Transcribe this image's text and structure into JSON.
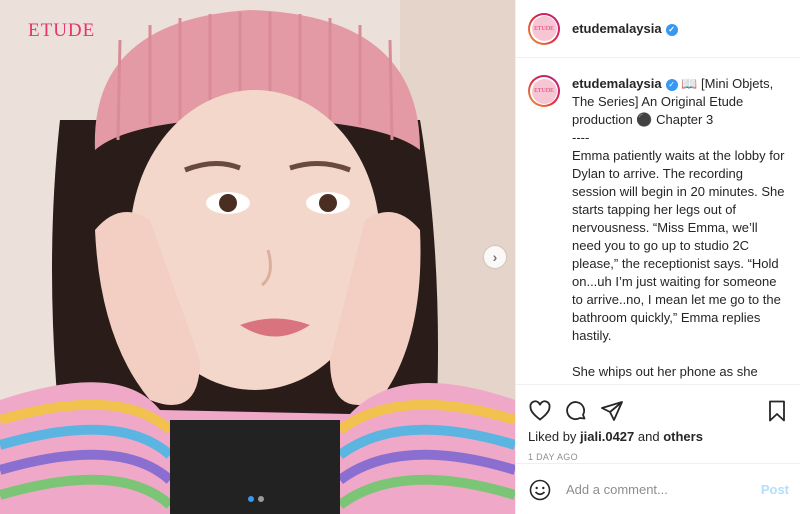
{
  "media": {
    "brand": "ETUDE",
    "next_icon": "chevron-right-icon",
    "carousel_total": 2,
    "carousel_active": 1
  },
  "header": {
    "avatar_text": "ETUDE",
    "username": "etudemalaysia",
    "verified_icon": "verified-badge-icon"
  },
  "caption": {
    "username": "etudemalaysia",
    "text": " 📖 [Mini Objets, The Series] An Original Etude production ⚫ Chapter 3\n----\nEmma patiently waits at the lobby for Dylan to arrive. The recording session will begin in 20 minutes. She starts tapping her legs out of nervousness. “Miss Emma, we’ll need you to go up to studio 2C please,” the receptionist says. “Hold on...uh I’m just waiting for someone to arrive..no, I mean let me go to the bathroom quickly,” Emma replies hastily.\n\nShe whips out her phone as she navigates through the long corridors of the building while dialing Dylan’s number. No answer. She’s starting"
  },
  "actions": {
    "icons": [
      "heart-icon",
      "comment-icon",
      "share-icon",
      "bookmark-icon"
    ],
    "likes_prefix": "Liked by",
    "liked_by_user": "jiali.0427",
    "likes_and": "and",
    "likes_others": "others",
    "date": "1 DAY AGO"
  },
  "comment": {
    "emoji_icon": "emoji-icon",
    "placeholder": "Add a comment...",
    "post_label": "Post"
  },
  "colors": {
    "brand": "#e6336b",
    "accent": "#3897f0",
    "post_disabled": "#b2dffc"
  }
}
